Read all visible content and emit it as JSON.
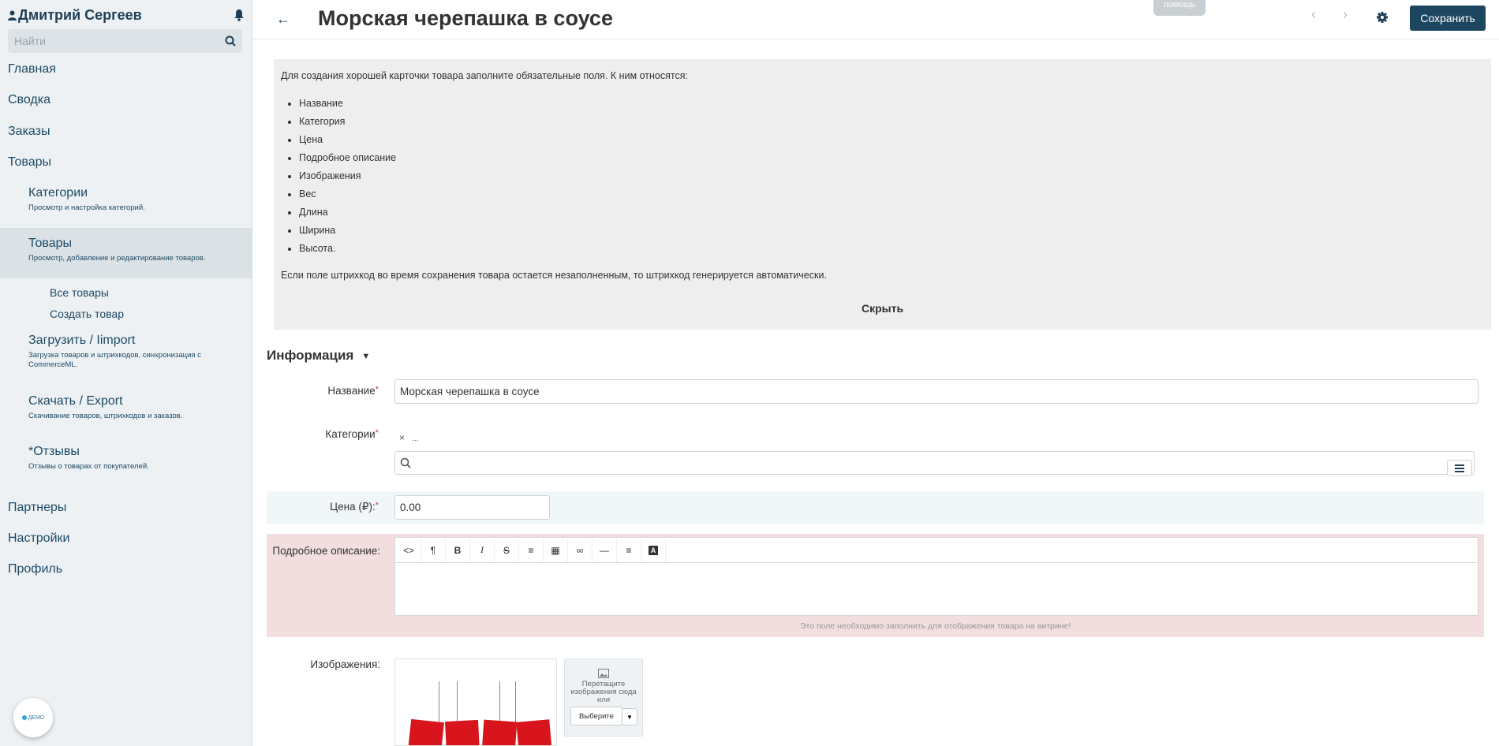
{
  "sidebar": {
    "user_name": "Дмитрий Сергеев",
    "search_placeholder": "Найти",
    "nav": {
      "home": "Главная",
      "summary": "Сводка",
      "orders": "Заказы",
      "products": "Товары",
      "categories": {
        "title": "Категории",
        "desc": "Просмотр и настройка категорий."
      },
      "products_sub": {
        "title": "Товары",
        "desc": "Просмотр, добавление и редактирование товаров."
      },
      "all_products": "Все товары",
      "create_product": "Создать товар",
      "import": {
        "title": "Загрузить / Iimport",
        "desc": "Загрузка товаров и штрихкодов, синхронизация с CommerceML."
      },
      "export": {
        "title": "Скачать / Export",
        "desc": "Скачивание товаров, штрихкодов и заказов."
      },
      "reviews": {
        "title": "*Отзывы",
        "desc": "Отзывы о товарах от покупателей."
      },
      "partners": "Партнеры",
      "settings": "Настройки",
      "profile": "Профиль"
    },
    "demo_badge": "ДЕМО"
  },
  "header": {
    "title": "Морская черепашка в соусе",
    "help": "помощь",
    "save_label": "Сохранить"
  },
  "info": {
    "intro": "Для создания хорошей карточки товара заполните обязательные поля. К ним относятся:",
    "fields": [
      "Название",
      "Категория",
      "Цена",
      "Подробное описание",
      "Изображения",
      "Вес",
      "Длина",
      "Ширина",
      "Высота."
    ],
    "note": "Если поле штрихкод во время сохранения товара остается незаполненным, то штрихкод генерируется автоматически.",
    "hide": "Скрыть"
  },
  "form": {
    "section_title": "Информация",
    "name_label": "Название",
    "name_value": "Морская черепашка в соусе",
    "categories_label": "Категории",
    "category_chip": "...",
    "price_label": "Цена (₽):",
    "price_value": "0.00",
    "description_label": "Подробное описание:",
    "description_hint": "Это поле необходимо заполнить для отображения товара на витрине!",
    "images_label": "Изображения:",
    "upload_text": "Перетащите изображения сюда или",
    "choose_label": "Выберите"
  },
  "colors": {
    "accent": "#1d4661",
    "sidebar_bg": "#edf1f3",
    "error_bg": "#f2dede",
    "required": "#d23b3b"
  }
}
